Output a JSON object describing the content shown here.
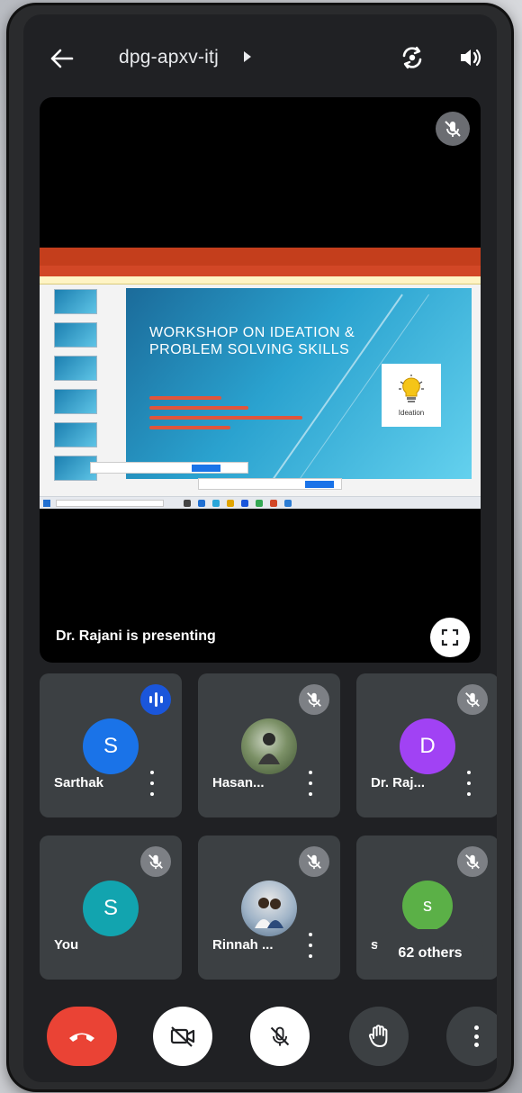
{
  "meeting": {
    "code": "dpg-apxv-itj"
  },
  "stage": {
    "presenting_label": "Dr. Rajani is presenting",
    "slide": {
      "title": "WORKSHOP ON IDEATION & PROBLEM SOLVING SKILLS",
      "image_label": "Ideation"
    }
  },
  "participants": [
    {
      "initial": "S",
      "name": "Sarthak",
      "color": "#1a73e8",
      "state": "speaking"
    },
    {
      "initial": "",
      "name": "Hasan...",
      "color": "#6f8a5b",
      "state": "muted"
    },
    {
      "initial": "D",
      "name": "Dr. Raj...",
      "color": "#a142f4",
      "state": "muted"
    },
    {
      "initial": "S",
      "name": "You",
      "color": "#12a4af",
      "state": "muted"
    },
    {
      "initial": "",
      "name": "Rinnah ...",
      "color": "#8aa0b6",
      "state": "muted"
    },
    {
      "initial": "s",
      "name": "ser",
      "color": "#5bb047",
      "state": "muted"
    }
  ],
  "others_label": "62 others",
  "icons": {
    "back": "arrow-left-icon",
    "flip_camera": "flip-camera-icon",
    "speaker": "speaker-icon",
    "muted": "mic-off-icon",
    "fullscreen": "fullscreen-icon",
    "end_call": "phone-hangup-icon",
    "camera_off": "camera-off-icon",
    "mic_off": "mic-off-icon",
    "raise_hand": "hand-icon",
    "more": "more-vertical-icon"
  },
  "colors": {
    "end_call": "#ea4335",
    "speaking": "#1a56db",
    "background": "#202124"
  }
}
